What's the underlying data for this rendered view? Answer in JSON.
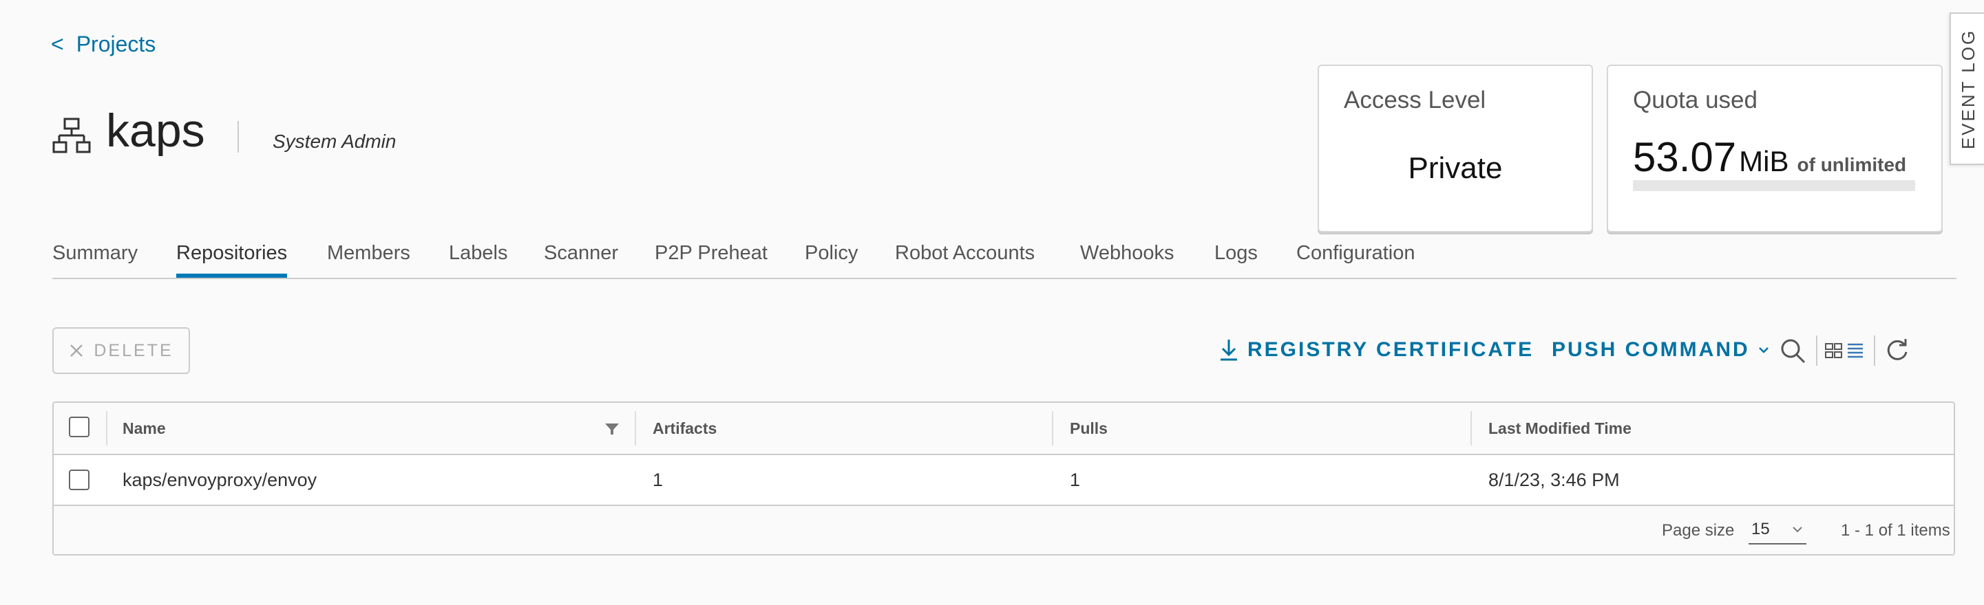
{
  "breadcrumb": {
    "back_symbol": "<",
    "label": "Projects"
  },
  "project": {
    "name": "kaps",
    "role": "System Admin",
    "icon": "project-tree-icon"
  },
  "access_card": {
    "title": "Access Level",
    "value": "Private"
  },
  "quota_card": {
    "title": "Quota used",
    "value": "53.07",
    "unit": "MiB",
    "suffix": "of unlimited",
    "used_fraction": 0
  },
  "event_log": {
    "label": "EVENT LOG"
  },
  "tabs": [
    {
      "label": "Summary",
      "active": false
    },
    {
      "label": "Repositories",
      "active": true
    },
    {
      "label": "Members",
      "active": false
    },
    {
      "label": "Labels",
      "active": false
    },
    {
      "label": "Scanner",
      "active": false
    },
    {
      "label": "P2P Preheat",
      "active": false
    },
    {
      "label": "Policy",
      "active": false
    },
    {
      "label": "Robot Accounts",
      "active": false
    },
    {
      "label": "Webhooks",
      "active": false
    },
    {
      "label": "Logs",
      "active": false
    },
    {
      "label": "Configuration",
      "active": false
    }
  ],
  "toolbar": {
    "delete_label": "DELETE",
    "registry_certificate_label": "REGISTRY CERTIFICATE",
    "push_command_label": "PUSH COMMAND"
  },
  "table": {
    "columns": [
      "Name",
      "Artifacts",
      "Pulls",
      "Last Modified Time"
    ],
    "rows": [
      {
        "name": "kaps/envoyproxy/envoy",
        "artifacts": "1",
        "pulls": "1",
        "last_modified": "8/1/23, 3:46 PM"
      }
    ],
    "footer": {
      "page_size_label": "Page size",
      "page_size": "15",
      "range": "1 - 1 of 1 items"
    }
  },
  "colors": {
    "accent": "#0072a3",
    "tab_underline": "#0079b8",
    "border": "#cccccc",
    "background": "#fafafa"
  }
}
